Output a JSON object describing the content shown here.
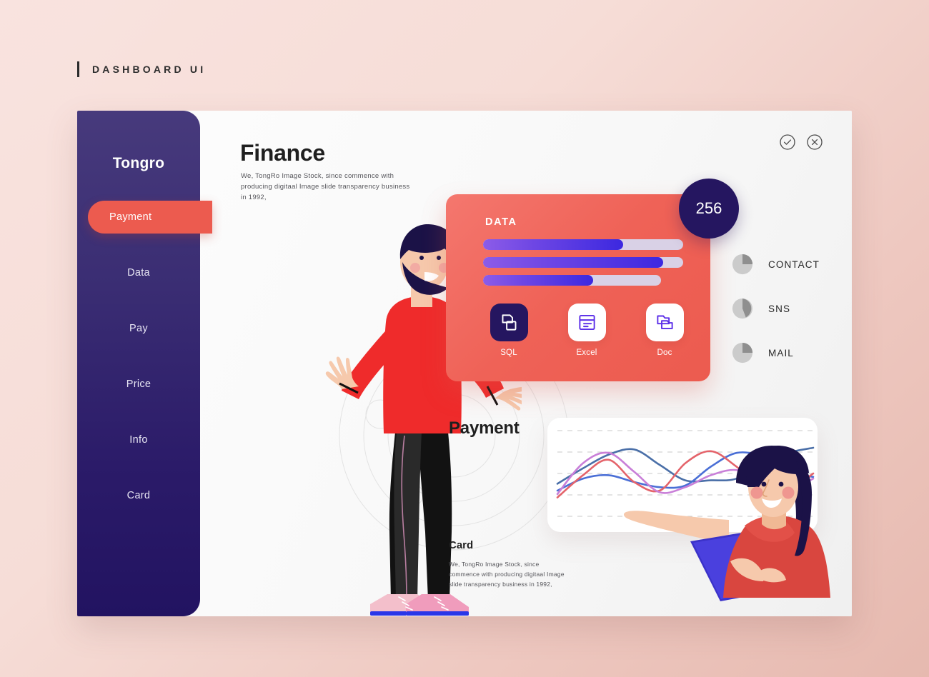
{
  "header": {
    "title": "DASHBOARD UI"
  },
  "sidebar": {
    "brand": "Tongro",
    "items": [
      {
        "label": "Payment",
        "active": true
      },
      {
        "label": "Data",
        "active": false
      },
      {
        "label": "Pay",
        "active": false
      },
      {
        "label": "Price",
        "active": false
      },
      {
        "label": "Info",
        "active": false
      },
      {
        "label": "Card",
        "active": false
      }
    ]
  },
  "main": {
    "title": "Finance",
    "description": "We, TongRo Image Stock, since commence with producing digitaal Image slide transparency business in 1992,",
    "top_actions": [
      {
        "name": "confirm-icon",
        "glyph": "check"
      },
      {
        "name": "close-icon",
        "glyph": "x"
      }
    ]
  },
  "data_card": {
    "title": "DATA",
    "bars": [
      {
        "percent": 70,
        "track_width": 100
      },
      {
        "percent": 90,
        "track_width": 100
      },
      {
        "percent": 62,
        "track_width": 89
      }
    ],
    "apps": [
      {
        "label": "SQL",
        "icon": "database-icon",
        "style": "dark"
      },
      {
        "label": "Excel",
        "icon": "spreadsheet-icon",
        "style": "light"
      },
      {
        "label": "Doc",
        "icon": "document-copy-icon",
        "style": "light"
      }
    ]
  },
  "badge": {
    "value": "256"
  },
  "stats": [
    {
      "label": "CONTACT",
      "percent": 25
    },
    {
      "label": "SNS",
      "percent": 36
    },
    {
      "label": "MAIL",
      "percent": 25
    }
  ],
  "payment": {
    "title": "Payment"
  },
  "card_section": {
    "title": "Card",
    "description": "We, TongRo Image Stock, since commence with producing digitaal Image slide transparency business in 1992,"
  },
  "chart_data": {
    "type": "line",
    "title": "",
    "xlabel": "",
    "ylabel": "",
    "grid": true,
    "gridlines": 5,
    "legend_position": "none",
    "x": [
      0,
      10,
      20,
      30,
      40,
      50,
      60,
      70,
      80,
      90,
      100
    ],
    "ylim": [
      0,
      100
    ],
    "series": [
      {
        "name": "series-blue-dark",
        "color": "#4a6fa8",
        "values": [
          38,
          56,
          72,
          78,
          60,
          42,
          42,
          44,
          62,
          74,
          80
        ]
      },
      {
        "name": "series-blue-light",
        "color": "#4a6fd6",
        "values": [
          30,
          44,
          48,
          40,
          34,
          36,
          58,
          74,
          70,
          52,
          46
        ]
      },
      {
        "name": "series-red",
        "color": "#e4636a",
        "values": [
          22,
          48,
          66,
          40,
          30,
          62,
          76,
          58,
          34,
          30,
          50
        ]
      },
      {
        "name": "series-violet",
        "color": "#c97fd8",
        "values": [
          26,
          62,
          74,
          52,
          28,
          34,
          48,
          54,
          42,
          30,
          44
        ]
      }
    ]
  },
  "colors": {
    "accent_red": "#ec5b4f",
    "sidebar_top": "#473a7c",
    "sidebar_bottom": "#221361",
    "badge_navy": "#251660",
    "bar_purple": "#6f47e4",
    "bar_track": "#d9d1e6",
    "background_start": "#f9e3df",
    "background_end": "#e6b9af"
  }
}
